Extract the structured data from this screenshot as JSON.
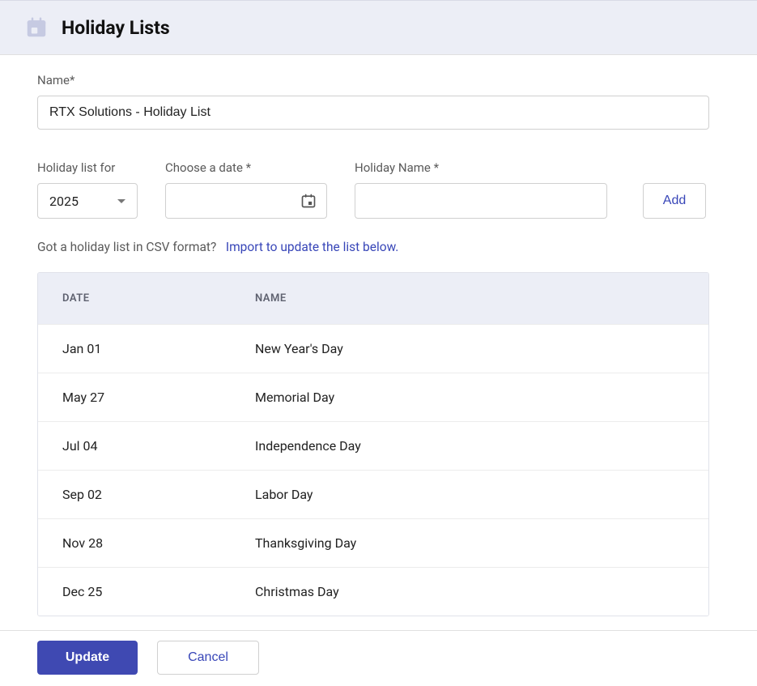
{
  "header": {
    "title": "Holiday Lists"
  },
  "form": {
    "name_label": "Name*",
    "name_value": "RTX Solutions - Holiday List",
    "year_label": "Holiday list for",
    "year_value": "2025",
    "date_label": "Choose a date *",
    "date_value": "",
    "holiday_name_label": "Holiday Name *",
    "holiday_name_value": "",
    "add_label": "Add"
  },
  "import": {
    "prompt": "Got a holiday list in CSV format?",
    "link": "Import to update the list below."
  },
  "table": {
    "headers": {
      "date": "DATE",
      "name": "NAME"
    },
    "rows": [
      {
        "date": "Jan 01",
        "name": "New Year's Day"
      },
      {
        "date": "May 27",
        "name": "Memorial Day"
      },
      {
        "date": "Jul 04",
        "name": "Independence Day"
      },
      {
        "date": "Sep 02",
        "name": "Labor Day"
      },
      {
        "date": "Nov 28",
        "name": "Thanksgiving Day"
      },
      {
        "date": "Dec 25",
        "name": "Christmas Day"
      }
    ]
  },
  "footer": {
    "update": "Update",
    "cancel": "Cancel"
  }
}
